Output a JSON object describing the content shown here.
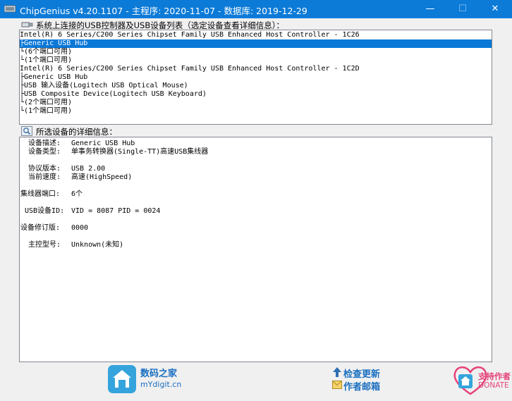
{
  "window": {
    "title": "ChipGenius v4.20.1107 - 主程序: 2020-11-07 - 数据库: 2019-12-29",
    "minimize": "—",
    "maximize": "☐",
    "close": "✕"
  },
  "device_list": {
    "label": "系统上连接的USB控制器及USB设备列表（选定设备查看详细信息）：",
    "rows": [
      "Intel(R) 6 Series/C200 Series Chipset Family USB Enhanced Host Controller - 1C26",
      "├Generic USB Hub",
      "  └(6个端口可用)",
      "└(1个端口可用)",
      "Intel(R) 6 Series/C200 Series Chipset Family USB Enhanced Host Controller - 1C2D",
      "├Generic USB Hub",
      "  ├USB 输入设备(Logitech USB Optical Mouse)",
      "  ├USB Composite Device(Logitech USB Keyboard)",
      "  └(2个端口可用)",
      "└(1个端口可用)"
    ],
    "selected_index": 1
  },
  "details": {
    "label": "所选设备的详细信息：",
    "rows": [
      {
        "label": "设备描述:",
        "value": "Generic USB Hub"
      },
      {
        "label": "设备类型:",
        "value": "单事务转换器(Single-TT)高速USB集线器"
      },
      {
        "label": "协议版本:",
        "value": "USB 2.00"
      },
      {
        "label": "当前速度:",
        "value": "高速(HighSpeed)"
      },
      {
        "label": "集线器端口:",
        "value": "6个"
      },
      {
        "label": "USB设备ID:",
        "value": "VID = 8087 PID = 0024"
      },
      {
        "label": "设备修订版:",
        "value": "0000"
      },
      {
        "label": "主控型号:",
        "value": "Unknown(未知)"
      }
    ]
  },
  "footer": {
    "site_name": "数码之家",
    "site_url": "mYdigit.cn",
    "check_update": "检查更新",
    "email_author": "作者邮箱",
    "support_author": "支持作者",
    "donate": "DONATE"
  },
  "colors": {
    "title_bar": "#0c7bd8",
    "selection": "#0a78d7",
    "link": "#1a6fc0",
    "donate": "#e6427a"
  }
}
